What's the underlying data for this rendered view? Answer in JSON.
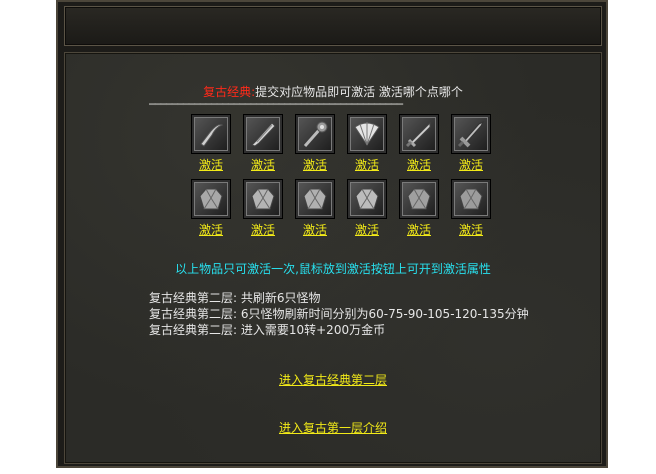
{
  "panel": {
    "title_red": "复古经典:",
    "title_rest": "提交对应物品即可激活 激活哪个点哪个",
    "divider": "━━━━━━━━━━━━━━━━━━━━━━━━━━━━━━━━━━━━━━━━━━━━━"
  },
  "items_row1": [
    {
      "icon": "scythe-blade-icon",
      "label": "激活"
    },
    {
      "icon": "broad-blade-icon",
      "label": "激活"
    },
    {
      "icon": "dragon-staff-icon",
      "label": "激活"
    },
    {
      "icon": "folding-fan-icon",
      "label": "激活"
    },
    {
      "icon": "long-sword-icon",
      "label": "激活"
    },
    {
      "icon": "great-sword-icon",
      "label": "激活"
    }
  ],
  "items_row2": [
    {
      "icon": "armor-piece-icon",
      "label": "激活"
    },
    {
      "icon": "armor-piece-icon",
      "label": "激活"
    },
    {
      "icon": "armor-piece-icon",
      "label": "激活"
    },
    {
      "icon": "armor-piece-icon",
      "label": "激活"
    },
    {
      "icon": "armor-piece-icon",
      "label": "激活"
    },
    {
      "icon": "armor-piece-icon",
      "label": "激活"
    }
  ],
  "hint": "以上物品只可激活一次,鼠标放到激活按钮上可开到激活属性",
  "info": [
    "复古经典第二层: 共刷新6只怪物",
    "复古经典第二层: 6只怪物刷新时间分别为60-75-90-105-120-135分钟",
    "复古经典第二层: 进入需要10转+200万金币"
  ],
  "links": {
    "enter_second": "进入复古经典第二层",
    "enter_intro": "进入复古第一层介绍"
  }
}
